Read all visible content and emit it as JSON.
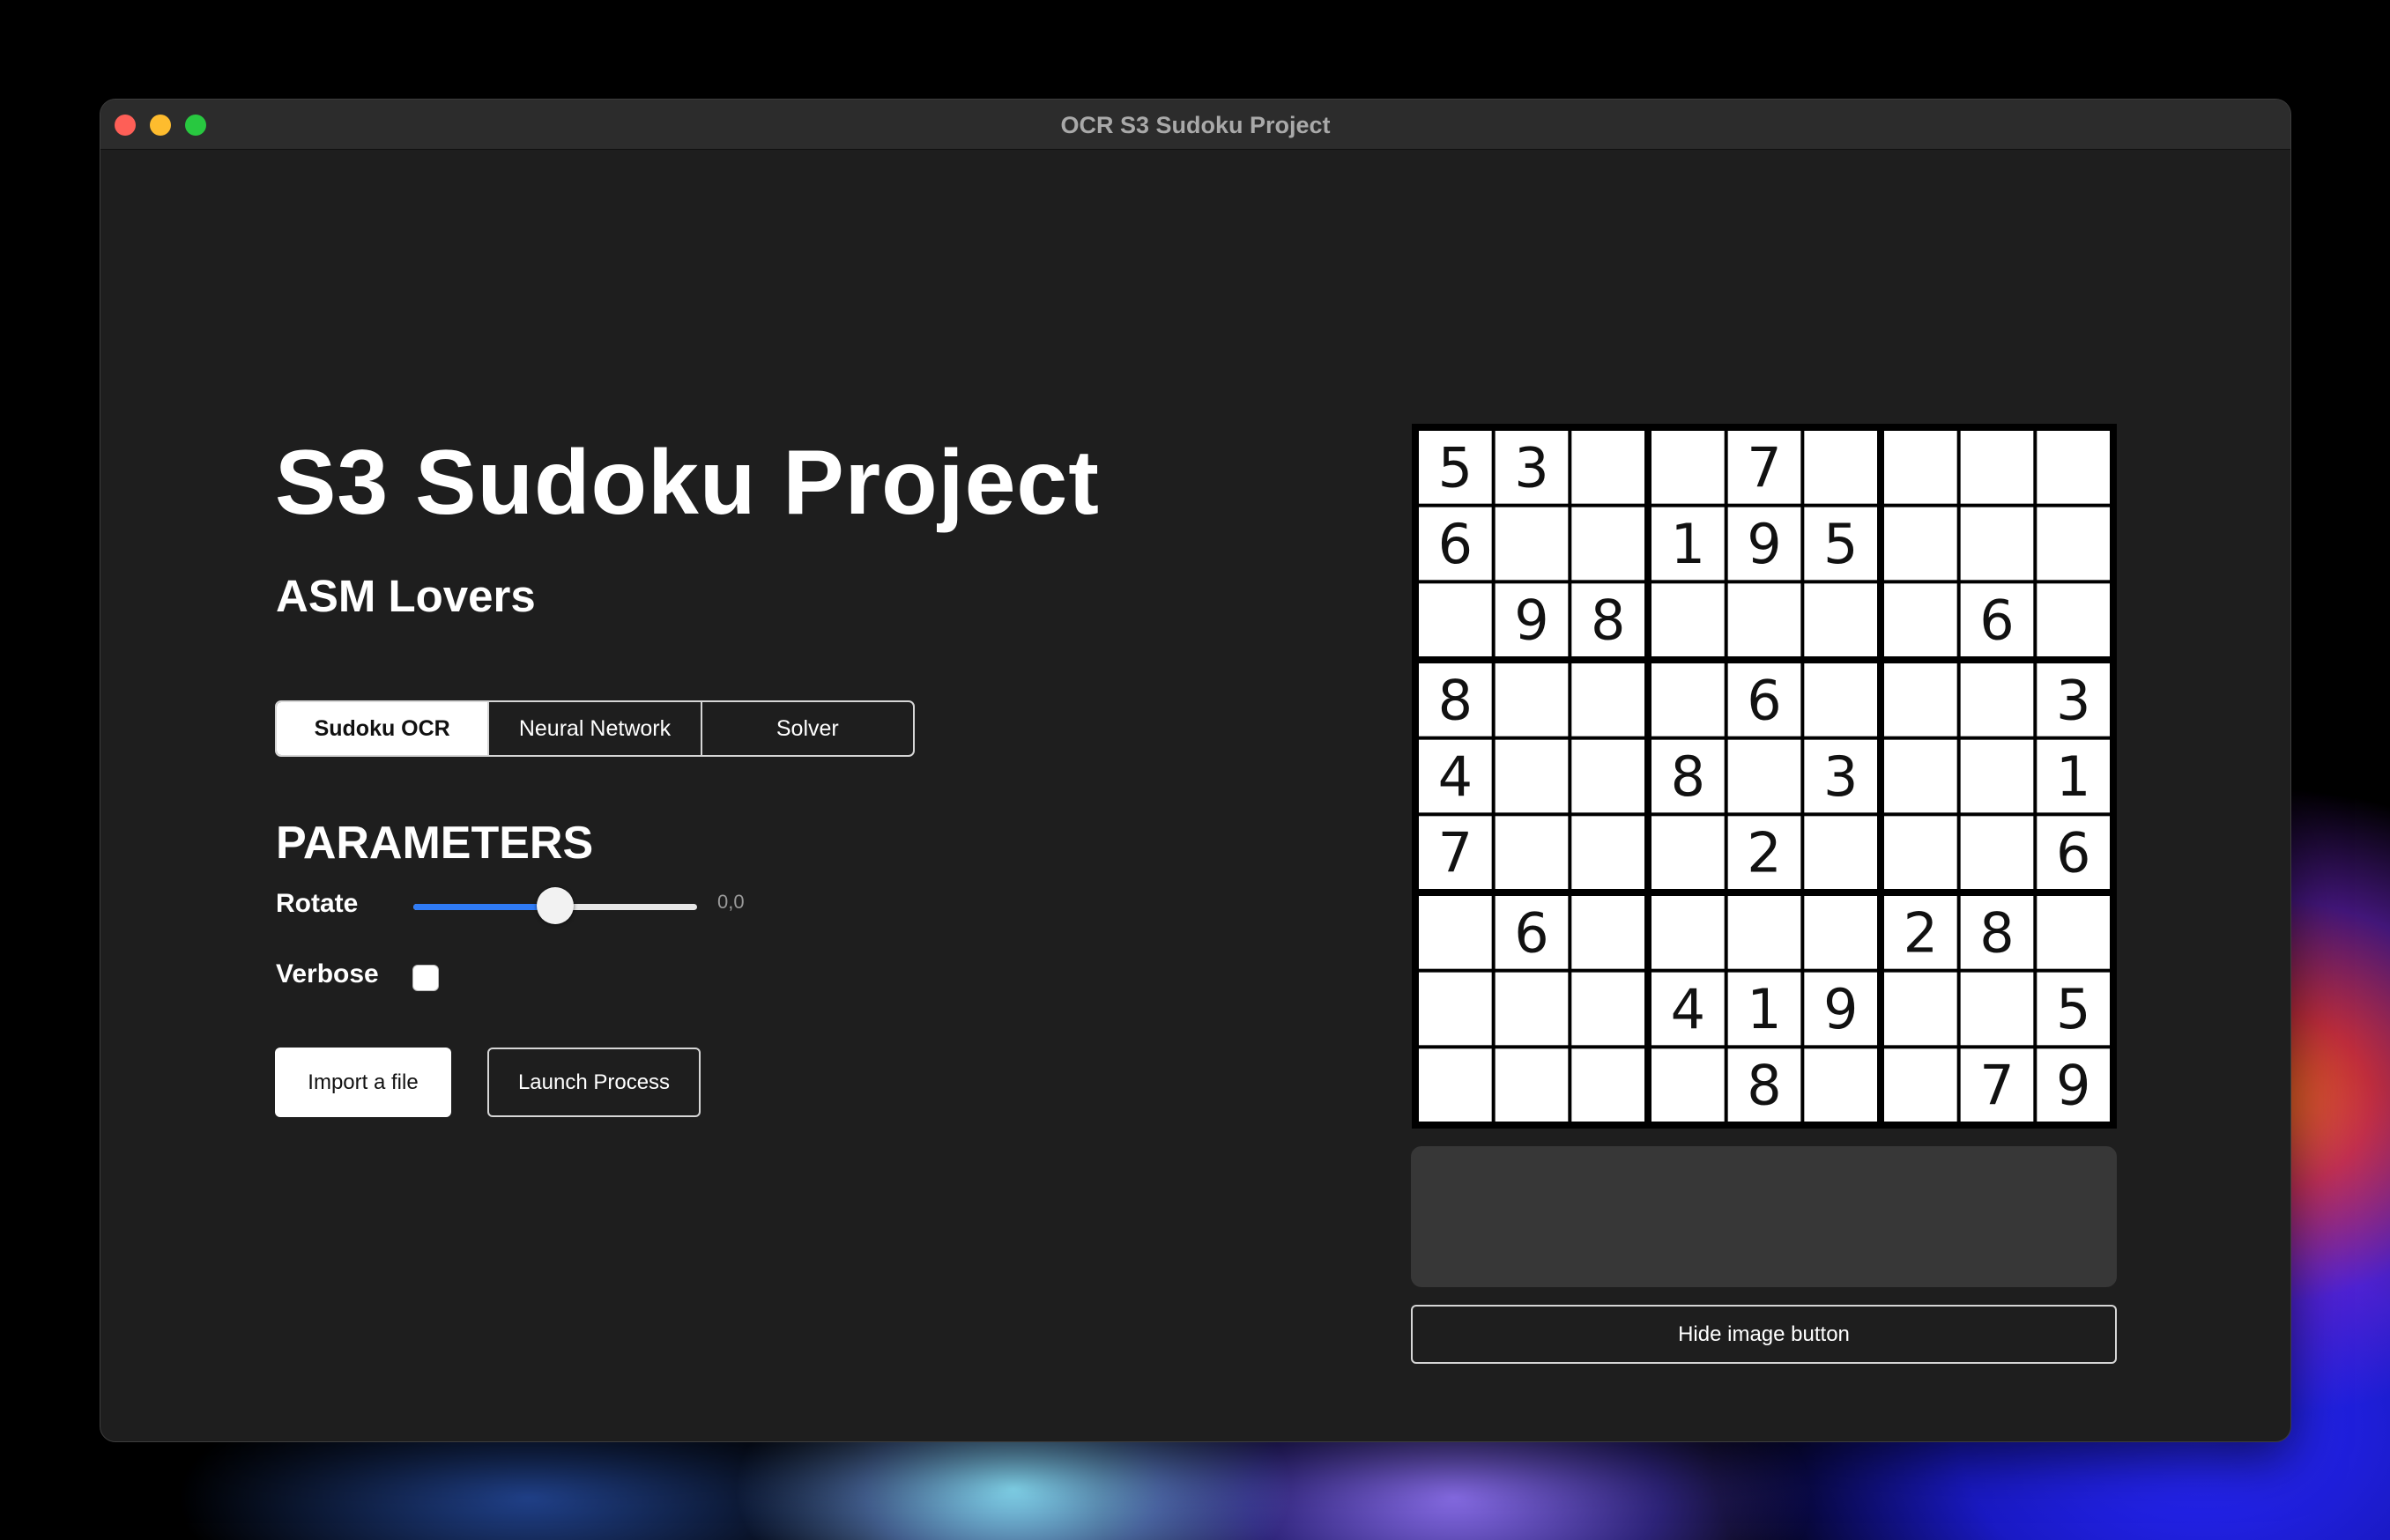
{
  "window": {
    "title": "OCR S3 Sudoku Project"
  },
  "header": {
    "title": "S3 Sudoku Project",
    "subtitle": "ASM Lovers"
  },
  "tabs": [
    {
      "label": "Sudoku OCR",
      "active": true
    },
    {
      "label": "Neural Network",
      "active": false
    },
    {
      "label": "Solver",
      "active": false
    }
  ],
  "parameters": {
    "heading": "PARAMETERS",
    "rotate": {
      "label": "Rotate",
      "value_text": "0,0",
      "position_fraction": 0.5
    },
    "verbose": {
      "label": "Verbose",
      "checked": false
    }
  },
  "actions": {
    "import_label": "Import a file",
    "launch_label": "Launch Process"
  },
  "preview": {
    "hide_button_label": "Hide image button",
    "output_text": "",
    "grid": [
      [
        5,
        3,
        0,
        0,
        7,
        0,
        0,
        0,
        0
      ],
      [
        6,
        0,
        0,
        1,
        9,
        5,
        0,
        0,
        0
      ],
      [
        0,
        9,
        8,
        0,
        0,
        0,
        0,
        6,
        0
      ],
      [
        8,
        0,
        0,
        0,
        6,
        0,
        0,
        0,
        3
      ],
      [
        4,
        0,
        0,
        8,
        0,
        3,
        0,
        0,
        1
      ],
      [
        7,
        0,
        0,
        0,
        2,
        0,
        0,
        0,
        6
      ],
      [
        0,
        6,
        0,
        0,
        0,
        0,
        2,
        8,
        0
      ],
      [
        0,
        0,
        0,
        4,
        1,
        9,
        0,
        0,
        5
      ],
      [
        0,
        0,
        0,
        0,
        8,
        0,
        0,
        7,
        9
      ]
    ]
  },
  "colors": {
    "window_bg": "#1e1e1e",
    "titlebar_bg": "#2c2c2c",
    "slider_accent": "#2f7bf5",
    "output_box_bg": "#373737"
  }
}
